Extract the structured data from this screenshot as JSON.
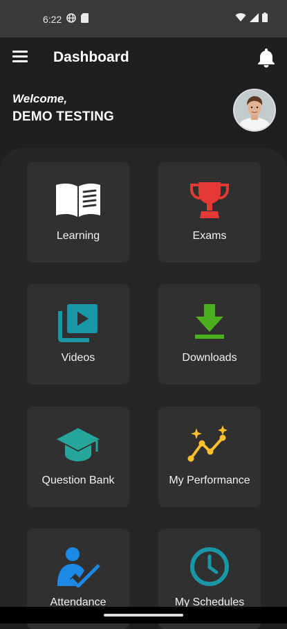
{
  "status": {
    "time": "6:22",
    "icons": [
      "vpn-globe-icon",
      "sd-card-icon",
      "wifi-icon",
      "signal-icon",
      "battery-icon"
    ]
  },
  "appbar": {
    "title": "Dashboard",
    "menu_icon": "hamburger-menu-icon",
    "notification_icon": "bell-icon"
  },
  "user": {
    "welcome": "Welcome,",
    "name": "DEMO TESTING"
  },
  "tiles": [
    {
      "label": "Learning",
      "icon": "book-icon",
      "color": "#ffffff"
    },
    {
      "label": "Exams",
      "icon": "trophy-icon",
      "color": "#e53935"
    },
    {
      "label": "Videos",
      "icon": "video-library-icon",
      "color": "#1a97a6"
    },
    {
      "label": "Downloads",
      "icon": "download-icon",
      "color": "#4caf1f"
    },
    {
      "label": "Question Bank",
      "icon": "graduation-cap-icon",
      "color": "#26a69a"
    },
    {
      "label": "My Performance",
      "icon": "performance-chart-icon",
      "color": "#fbc02d"
    },
    {
      "label": "Attendance",
      "icon": "attendance-person-check-icon",
      "color": "#1e88e5"
    },
    {
      "label": "My Schedules",
      "icon": "clock-icon",
      "color": "#1a97a6"
    }
  ]
}
